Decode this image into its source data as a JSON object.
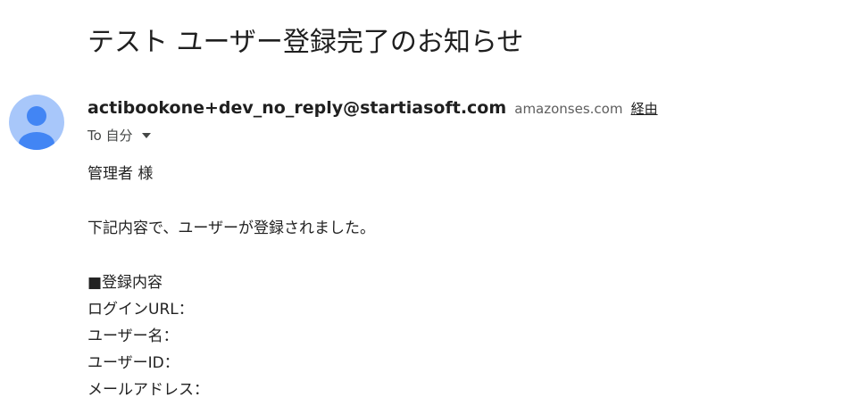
{
  "email": {
    "subject": "テスト ユーザー登録完了のお知らせ",
    "sender": {
      "email": "actibookone+dev_no_reply@startiasoft.com",
      "via_domain": "amazonses.com",
      "via_label": "経由"
    },
    "recipient": {
      "to_label": "To 自分"
    },
    "body": {
      "greeting": "管理者 様",
      "intro": "下記内容で、ユーザーが登録されました。",
      "section_heading": "■登録内容",
      "fields": [
        "ログインURL：",
        "ユーザー名：",
        "ユーザーID：",
        "メールアドレス："
      ]
    }
  },
  "icons": {
    "avatar": "default-person-avatar-icon",
    "details": "caret-down-icon"
  },
  "colors": {
    "avatar_bg": "#a8c7fa",
    "avatar_fg": "#4285f4"
  }
}
